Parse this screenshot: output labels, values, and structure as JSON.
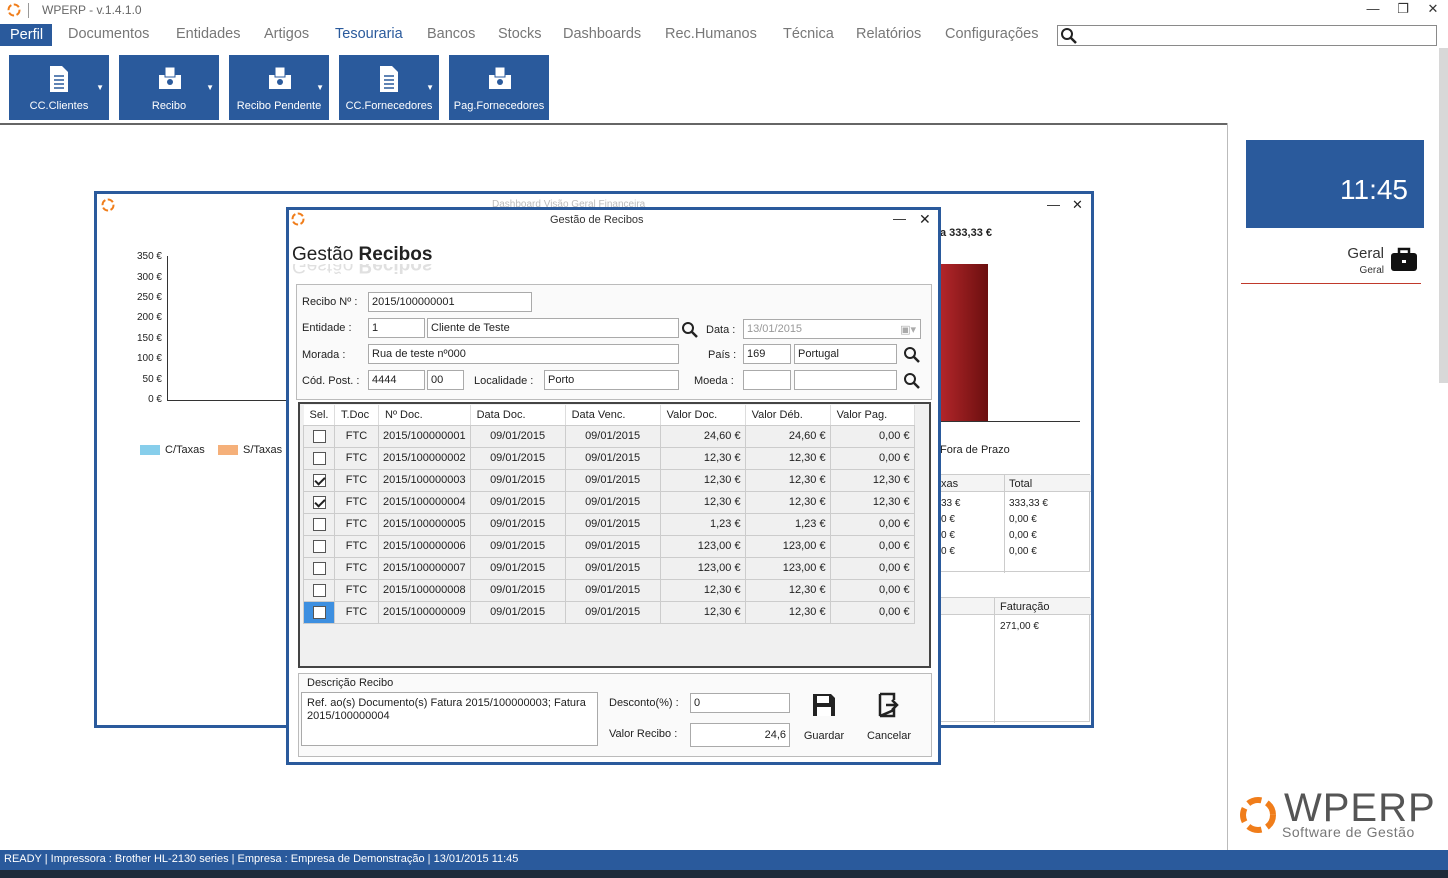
{
  "window": {
    "title": "WPERP - v.1.4.1.0"
  },
  "menu": {
    "items": [
      "Perfil",
      "Documentos",
      "Entidades",
      "Artigos",
      "Tesouraria",
      "Bancos",
      "Stocks",
      "Dashboards",
      "Rec.Humanos",
      "Técnica",
      "Relatórios",
      "Configurações"
    ],
    "active": "Tesouraria"
  },
  "ribbon": {
    "buttons": [
      {
        "label": "CC.Clientes",
        "icon": "document-icon",
        "dropdown": true
      },
      {
        "label": "Recibo",
        "icon": "receipt-icon",
        "dropdown": true
      },
      {
        "label": "Recibo Pendente",
        "icon": "receipt-icon",
        "dropdown": true
      },
      {
        "label": "CC.Fornecedores",
        "icon": "document-icon",
        "dropdown": true
      },
      {
        "label": "Pag.Fornecedores",
        "icon": "receipt-icon",
        "dropdown": false
      }
    ]
  },
  "clock": {
    "time": "11:45"
  },
  "company": {
    "title": "Geral",
    "subtitle": "Geral"
  },
  "brand": {
    "name": "WPERP",
    "tagline": "Software de Gestão"
  },
  "dashboard": {
    "title": "Dashboard Visão Geral Financeira",
    "y_ticks": [
      "350 €",
      "300 €",
      "250 €",
      "200 €",
      "150 €",
      "100 €",
      "50 €",
      "0 €"
    ],
    "legend": [
      "C/Taxas",
      "S/Taxas"
    ],
    "total_label": "a 333,33 €",
    "fora_prazo": "Fora de Prazo",
    "table1": {
      "h1": "xas",
      "h2": "Total",
      "c1": [
        "33 €",
        "0 €",
        "0 €",
        "0 €"
      ],
      "c2": [
        "333,33 €",
        "0,00 €",
        "0,00 €",
        "0,00 €"
      ]
    },
    "table2": {
      "h": "Faturação",
      "v": "271,00 €"
    }
  },
  "dialog": {
    "title": "Gestão de Recibos",
    "heading_light": "Gestão",
    "heading_bold": "Recibos",
    "labels": {
      "recibo": "Recibo Nº :",
      "entidade": "Entidade :",
      "morada": "Morada :",
      "cod_post": "Cód. Post. :",
      "localidade": "Localidade :",
      "data": "Data :",
      "pais": "País :",
      "moeda": "Moeda :",
      "descricao": "Descrição Recibo",
      "desconto": "Desconto(%) :",
      "valor": "Valor Recibo :",
      "guardar": "Guardar",
      "cancelar": "Cancelar"
    },
    "values": {
      "recibo": "2015/100000001",
      "entidade_cod": "1",
      "entidade_nome": "Cliente de Teste",
      "morada": "Rua de teste nº000",
      "cp1": "4444",
      "cp2": "00",
      "localidade": "Porto",
      "data": "13/01/2015",
      "pais_cod": "169",
      "pais_nome": "Portugal",
      "moeda_cod": "",
      "moeda_nome": "",
      "descricao": "Ref. ao(s) Documento(s) Fatura 2015/100000003; Fatura 2015/100000004",
      "desconto": "0",
      "valor": "24,6"
    },
    "columns": [
      "Sel.",
      "T.Doc",
      "Nº Doc.",
      "Data Doc.",
      "Data Venc.",
      "Valor Doc.",
      "Valor Déb.",
      "Valor Pag."
    ],
    "rows": [
      {
        "sel": false,
        "tdoc": "FTC",
        "ndoc": "2015/100000001",
        "ddoc": "09/01/2015",
        "dvenc": "09/01/2015",
        "vdoc": "24,60 €",
        "vdeb": "24,60 €",
        "vpag": "0,00 €"
      },
      {
        "sel": false,
        "tdoc": "FTC",
        "ndoc": "2015/100000002",
        "ddoc": "09/01/2015",
        "dvenc": "09/01/2015",
        "vdoc": "12,30 €",
        "vdeb": "12,30 €",
        "vpag": "0,00 €"
      },
      {
        "sel": true,
        "tdoc": "FTC",
        "ndoc": "2015/100000003",
        "ddoc": "09/01/2015",
        "dvenc": "09/01/2015",
        "vdoc": "12,30 €",
        "vdeb": "12,30 €",
        "vpag": "12,30 €"
      },
      {
        "sel": true,
        "tdoc": "FTC",
        "ndoc": "2015/100000004",
        "ddoc": "09/01/2015",
        "dvenc": "09/01/2015",
        "vdoc": "12,30 €",
        "vdeb": "12,30 €",
        "vpag": "12,30 €"
      },
      {
        "sel": false,
        "tdoc": "FTC",
        "ndoc": "2015/100000005",
        "ddoc": "09/01/2015",
        "dvenc": "09/01/2015",
        "vdoc": "1,23 €",
        "vdeb": "1,23 €",
        "vpag": "0,00 €"
      },
      {
        "sel": false,
        "tdoc": "FTC",
        "ndoc": "2015/100000006",
        "ddoc": "09/01/2015",
        "dvenc": "09/01/2015",
        "vdoc": "123,00 €",
        "vdeb": "123,00 €",
        "vpag": "0,00 €"
      },
      {
        "sel": false,
        "tdoc": "FTC",
        "ndoc": "2015/100000007",
        "ddoc": "09/01/2015",
        "dvenc": "09/01/2015",
        "vdoc": "123,00 €",
        "vdeb": "123,00 €",
        "vpag": "0,00 €"
      },
      {
        "sel": false,
        "tdoc": "FTC",
        "ndoc": "2015/100000008",
        "ddoc": "09/01/2015",
        "dvenc": "09/01/2015",
        "vdoc": "12,30 €",
        "vdeb": "12,30 €",
        "vpag": "0,00 €"
      },
      {
        "sel": false,
        "tdoc": "FTC",
        "ndoc": "2015/100000009",
        "ddoc": "09/01/2015",
        "dvenc": "09/01/2015",
        "vdoc": "12,30 €",
        "vdeb": "12,30 €",
        "vpag": "0,00 €"
      }
    ]
  },
  "status": {
    "text": "READY | Impressora : Brother HL-2130 series  | Empresa : Empresa de Demonstração | 13/01/2015 11:45"
  },
  "colors": {
    "accent": "#2a5a9c",
    "brand_orange": "#f07d1a",
    "chart_bar": "#8e1c1c",
    "legend_c": "#87ceeb",
    "legend_s": "#f5b07a"
  }
}
